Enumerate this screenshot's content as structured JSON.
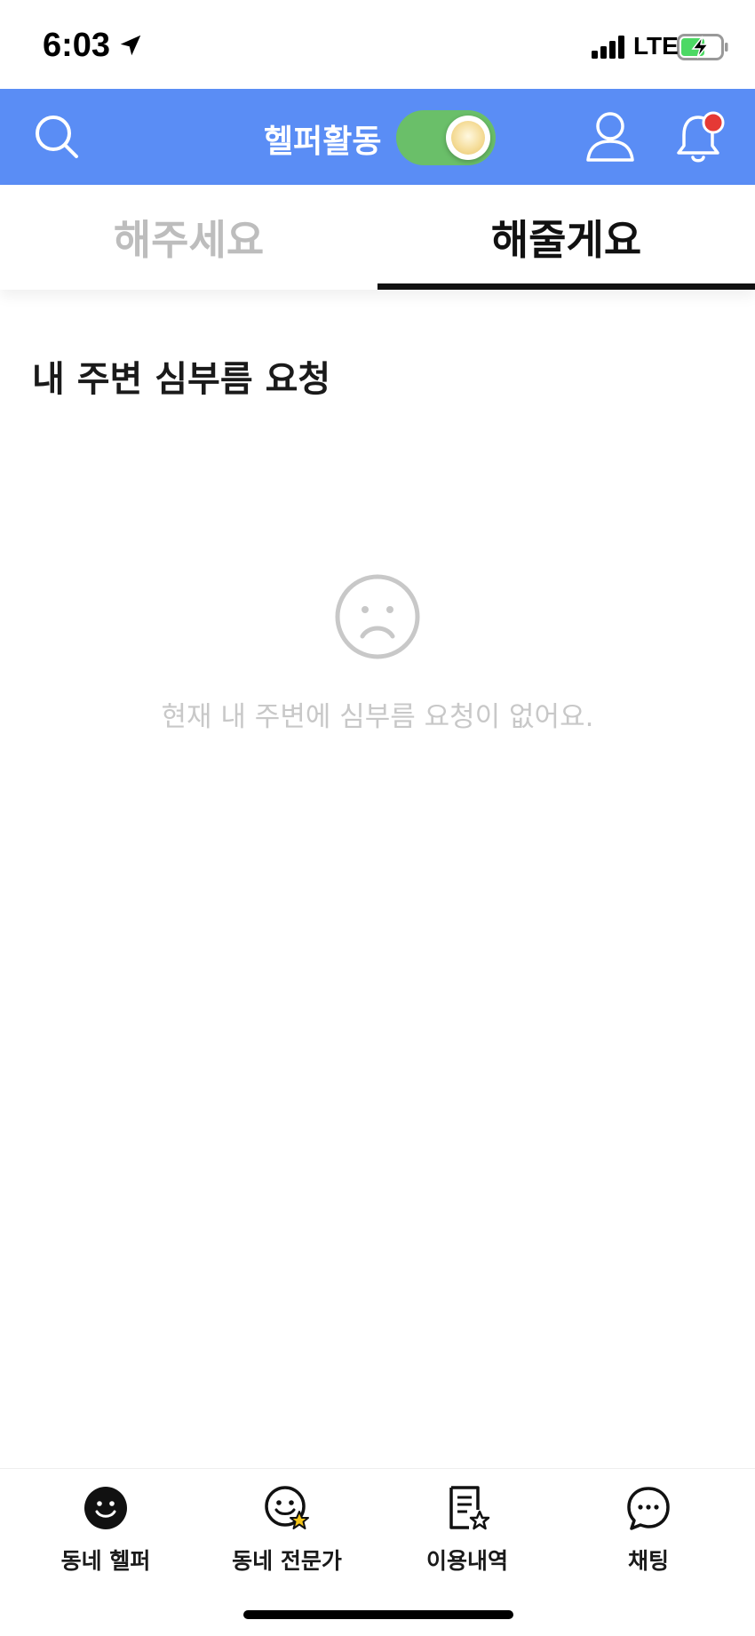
{
  "status_bar": {
    "time": "6:03",
    "network": "LTE"
  },
  "header": {
    "helper_label": "헬퍼활동",
    "toggle_on": true,
    "notification_badge_color": "#e53935",
    "header_color": "#5a8df5"
  },
  "tabs": [
    {
      "label": "해주세요",
      "active": false
    },
    {
      "label": "해줄게요",
      "active": true
    }
  ],
  "main": {
    "section_title": "내 주변 심부름 요청",
    "empty_message": "현재 내 주변에 심부름 요청이 없어요."
  },
  "bottom_nav": [
    {
      "label": "동네 헬퍼",
      "icon": "smile-filled-icon",
      "active": true
    },
    {
      "label": "동네 전문가",
      "icon": "smile-star-icon",
      "active": false
    },
    {
      "label": "이용내역",
      "icon": "document-star-icon",
      "active": false
    },
    {
      "label": "채팅",
      "icon": "chat-bubble-icon",
      "active": false
    }
  ]
}
